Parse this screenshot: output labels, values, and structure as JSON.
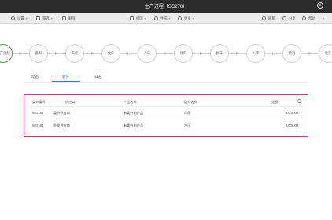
{
  "window": {
    "title": "生产过程（SC270）"
  },
  "toolbar": {
    "left": [
      {
        "label": "设置",
        "caret": true
      },
      {
        "label": "筛选",
        "caret": true
      },
      {
        "label": "删除",
        "caret": false
      }
    ],
    "center": [
      {
        "label": "打印",
        "caret": true
      },
      {
        "label": "生成",
        "caret": true
      },
      {
        "label": "更多",
        "caret": true
      }
    ],
    "right": [
      {
        "label": "刷新"
      },
      {
        "label": "分享"
      },
      {
        "label": "帮助"
      }
    ],
    "expand": "»"
  },
  "steps": [
    "生产计划",
    "备料",
    "工序",
    "委外",
    "人工",
    "领料",
    "加工",
    "入库",
    "检验",
    "委外"
  ],
  "tabs": [
    "动态",
    "委外",
    "日志"
  ],
  "table": {
    "headers": [
      "委外编号",
      "供应商",
      "产品名称",
      "委外名称",
      "金额"
    ],
    "rows": [
      [
        "WG185",
        "委外供应商",
        "有委外的产品",
        "车削",
        "3,000.00"
      ],
      [
        "WG184",
        "外发供应商",
        "有委外的产品",
        "冲压",
        "2,000.00"
      ]
    ]
  }
}
